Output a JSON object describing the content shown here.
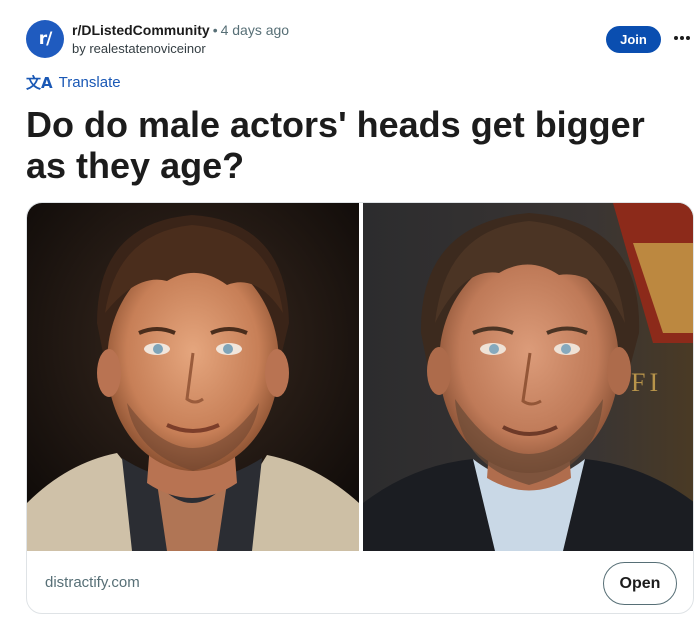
{
  "header": {
    "avatar_glyph": "r/",
    "subreddit": "r/DListedCommunity",
    "separator": "•",
    "time": "4 days ago",
    "author_line": "by realestatenoviceinor",
    "join_label": "Join",
    "more_icon": "ellipsis-icon"
  },
  "translate": {
    "icon": "文A",
    "label": "Translate"
  },
  "post": {
    "title": "Do do male actors' heads get bigger as they age?"
  },
  "link_card": {
    "images": [
      {
        "description_icon": "photo-young-actor"
      },
      {
        "description_icon": "photo-older-actor",
        "backdrop_text": "FI"
      }
    ],
    "domain": "distractify.com",
    "open_label": "Open"
  },
  "colors": {
    "accent": "#0a4eb0",
    "link": "#1a58b5",
    "muted": "#576f76"
  }
}
